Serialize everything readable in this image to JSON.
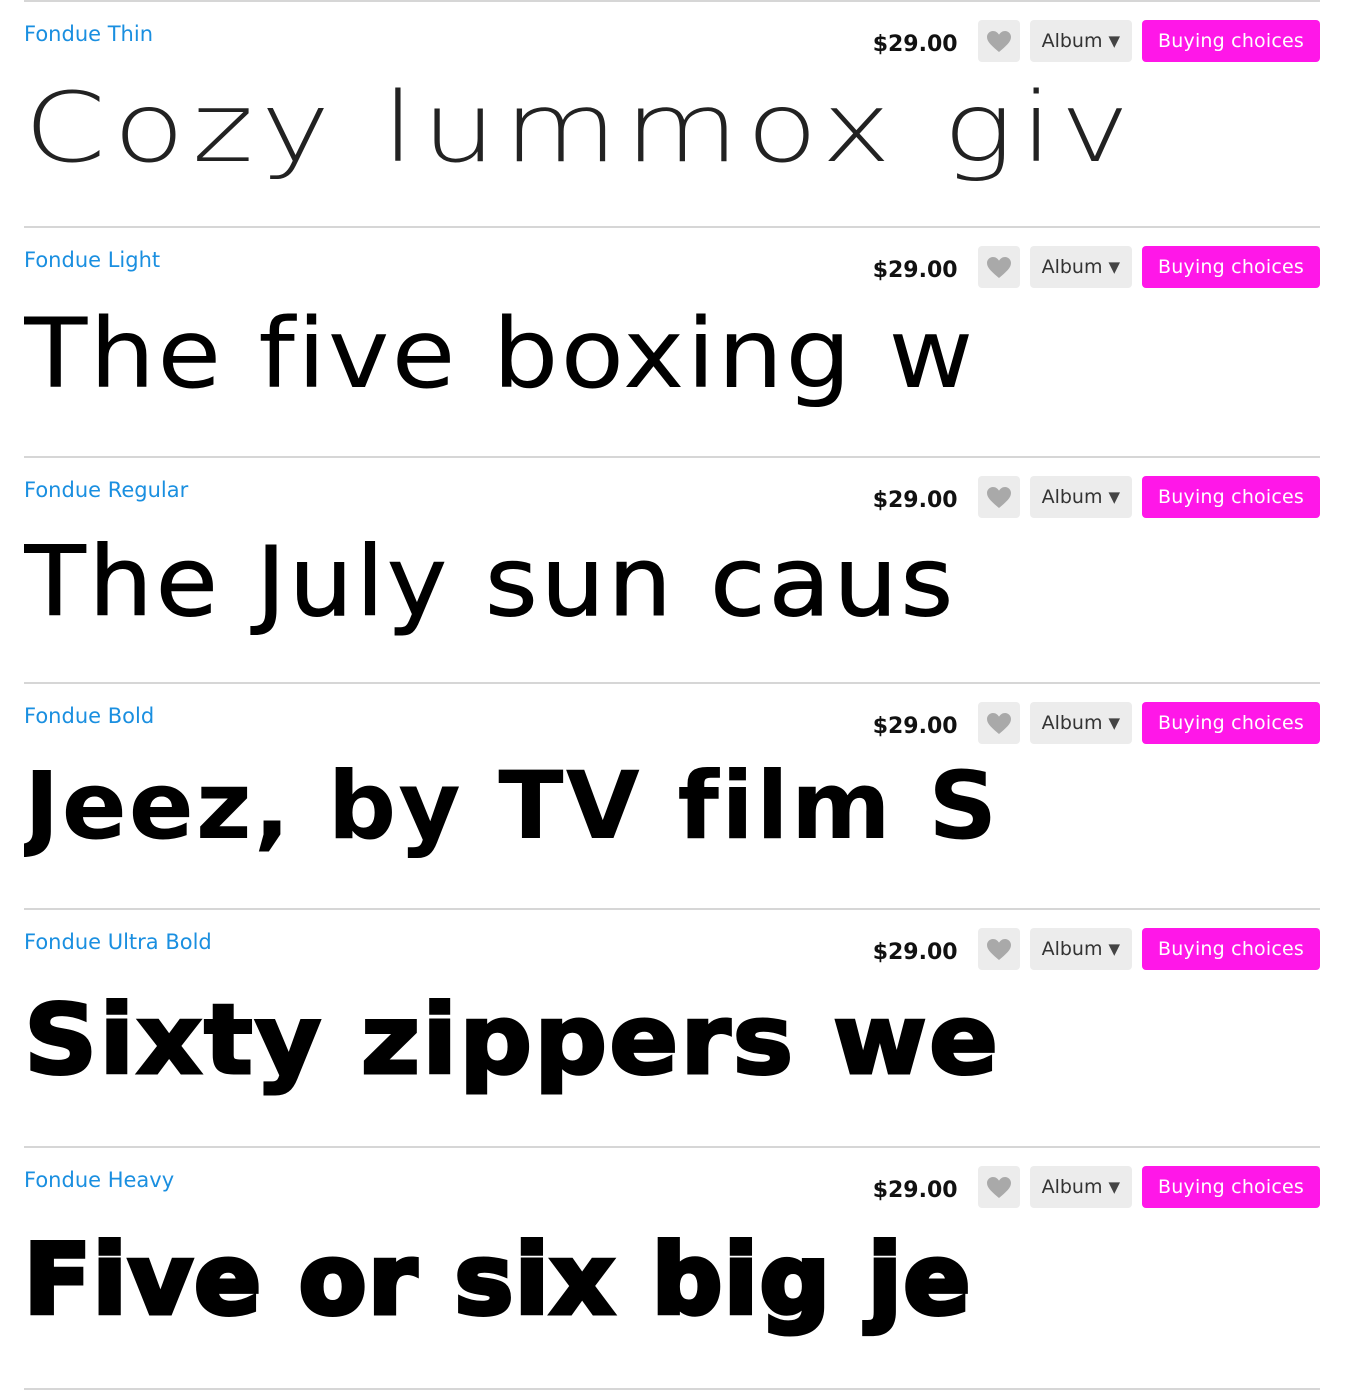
{
  "colors": {
    "font_name": "#1a8fe0",
    "buy_button": "#ff17e8",
    "button_gray": "#ececec",
    "favorite_icon": "#a9a9a9",
    "divider": "#d6d6d6"
  },
  "controls": {
    "favorite_icon": "heart-icon",
    "album_caret_icon": "caret-down-icon"
  },
  "fonts": [
    {
      "name": "Fondue Thin",
      "price": "$29.00",
      "album_label": "Album",
      "buy_label": "Buying choices",
      "sample": "Cozy lummox giv"
    },
    {
      "name": "Fondue Light",
      "price": "$29.00",
      "album_label": "Album",
      "buy_label": "Buying choices",
      "sample": "The five boxing w"
    },
    {
      "name": "Fondue Regular",
      "price": "$29.00",
      "album_label": "Album",
      "buy_label": "Buying choices",
      "sample": "The July sun caus"
    },
    {
      "name": "Fondue Bold",
      "price": "$29.00",
      "album_label": "Album",
      "buy_label": "Buying choices",
      "sample": "Jeez, by TV film S"
    },
    {
      "name": "Fondue Ultra Bold",
      "price": "$29.00",
      "album_label": "Album",
      "buy_label": "Buying choices",
      "sample": "Sixty zippers we"
    },
    {
      "name": "Fondue Heavy",
      "price": "$29.00",
      "album_label": "Album",
      "buy_label": "Buying choices",
      "sample": "Five or six big je"
    }
  ]
}
